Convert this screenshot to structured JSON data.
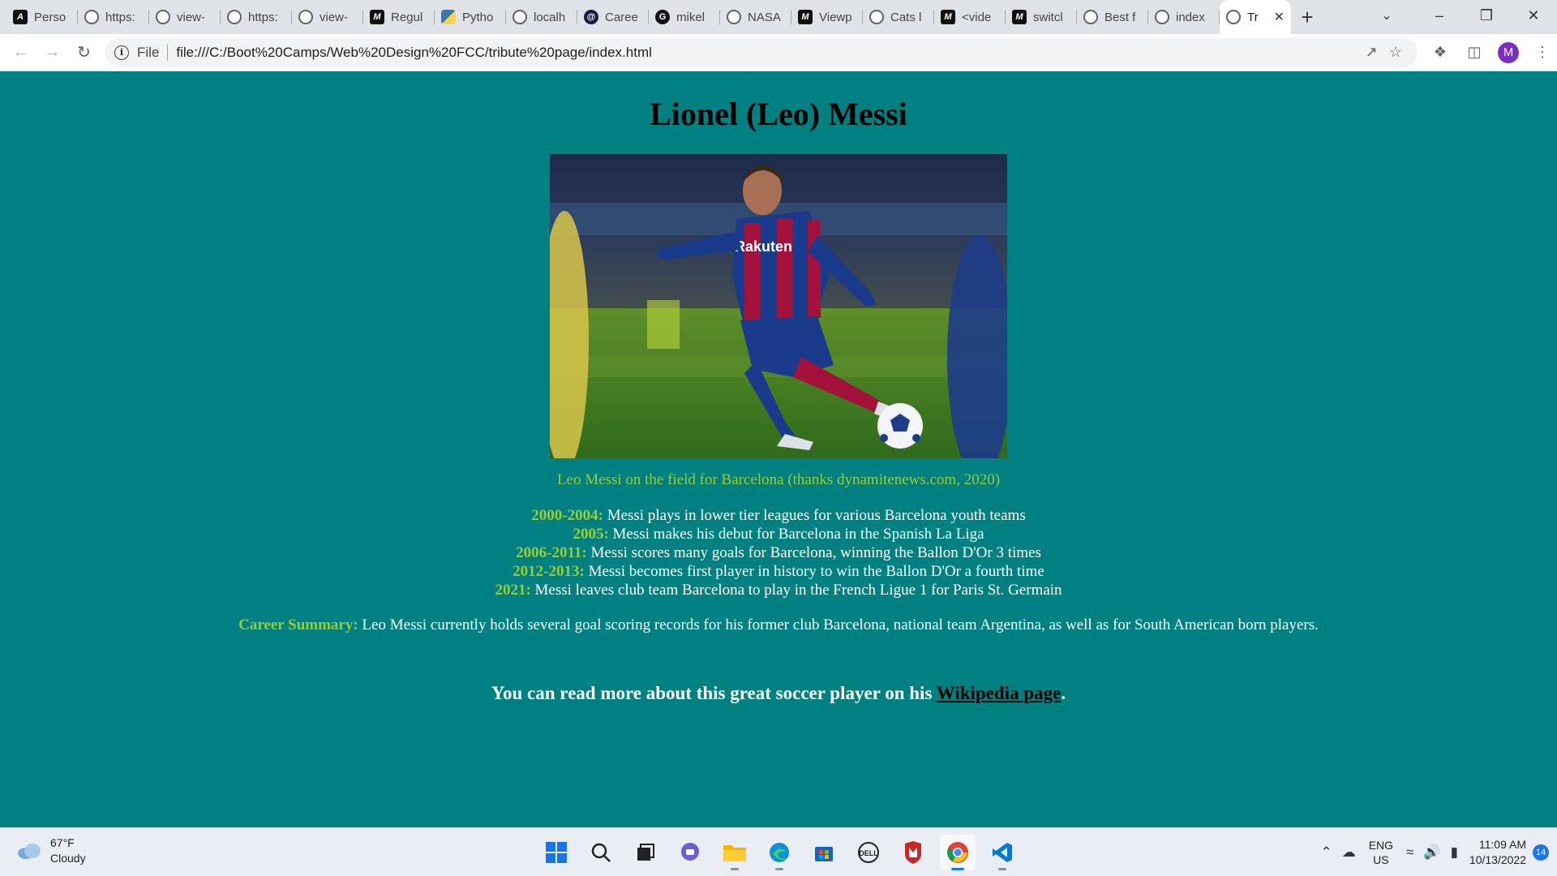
{
  "browser": {
    "tabs": [
      {
        "title": "Perso",
        "icon": "dark-logo-icon"
      },
      {
        "title": "https:",
        "icon": "globe-icon"
      },
      {
        "title": "view-",
        "icon": "globe-icon"
      },
      {
        "title": "https:",
        "icon": "globe-icon"
      },
      {
        "title": "view-",
        "icon": "globe-icon"
      },
      {
        "title": "Regul",
        "icon": "m-logo-icon"
      },
      {
        "title": "Pytho",
        "icon": "python-icon"
      },
      {
        "title": "localh",
        "icon": "globe-icon"
      },
      {
        "title": "Caree",
        "icon": "at-logo-icon"
      },
      {
        "title": "mikel",
        "icon": "github-icon"
      },
      {
        "title": "NASA",
        "icon": "globe-icon"
      },
      {
        "title": "Viewp",
        "icon": "m-logo-icon"
      },
      {
        "title": "Cats l",
        "icon": "globe-icon"
      },
      {
        "title": "<vide",
        "icon": "m-logo-icon"
      },
      {
        "title": "switcl",
        "icon": "m-logo-icon"
      },
      {
        "title": "Best f",
        "icon": "globe-icon"
      },
      {
        "title": "index",
        "icon": "globe-icon"
      },
      {
        "title": "Tr",
        "icon": "globe-icon",
        "active": true
      }
    ],
    "address_scheme": "File",
    "url": "file:///C:/Boot%20Camps/Web%20Design%20FCC/tribute%20page/index.html",
    "profile_initial": "M"
  },
  "page": {
    "title": "Lionel (Leo) Messi",
    "image_caption": "Leo Messi on the field for Barcelona (thanks dynamitenews.com, 2020)",
    "timeline": [
      {
        "years": "2000-2004:",
        "text": " Messi plays in lower tier leagues for various Barcelona youth teams"
      },
      {
        "years": "2005:",
        "text": " Messi makes his debut for Barcelona in the Spanish La Liga"
      },
      {
        "years": "2006-2011:",
        "text": " Messi scores many goals for Barcelona, winning the Ballon D'Or 3 times"
      },
      {
        "years": "2012-2013:",
        "text": " Messi becomes first player in history to win the Ballon D'Or a fourth time"
      },
      {
        "years": "2021:",
        "text": " Messi leaves club team Barcelona to play in the French Ligue 1 for Paris St. Germain"
      }
    ],
    "summary_label": "Career Summary:",
    "summary_text": " Leo Messi currently holds several goal scoring records for his former club Barcelona, national team Argentina, as well as for South American born players.",
    "more_prefix": "You can read more about this great soccer player on his ",
    "more_link": "Wikipedia page",
    "more_suffix": ".",
    "photo_shirt_text": "Rakuten"
  },
  "taskbar": {
    "temperature": "67°F",
    "condition": "Cloudy",
    "lang_top": "ENG",
    "lang_bottom": "US",
    "time": "11:09 AM",
    "date": "10/13/2022",
    "notifications": "14"
  },
  "colors": {
    "page_bg": "#008080",
    "accent_green": "#9acd32"
  }
}
